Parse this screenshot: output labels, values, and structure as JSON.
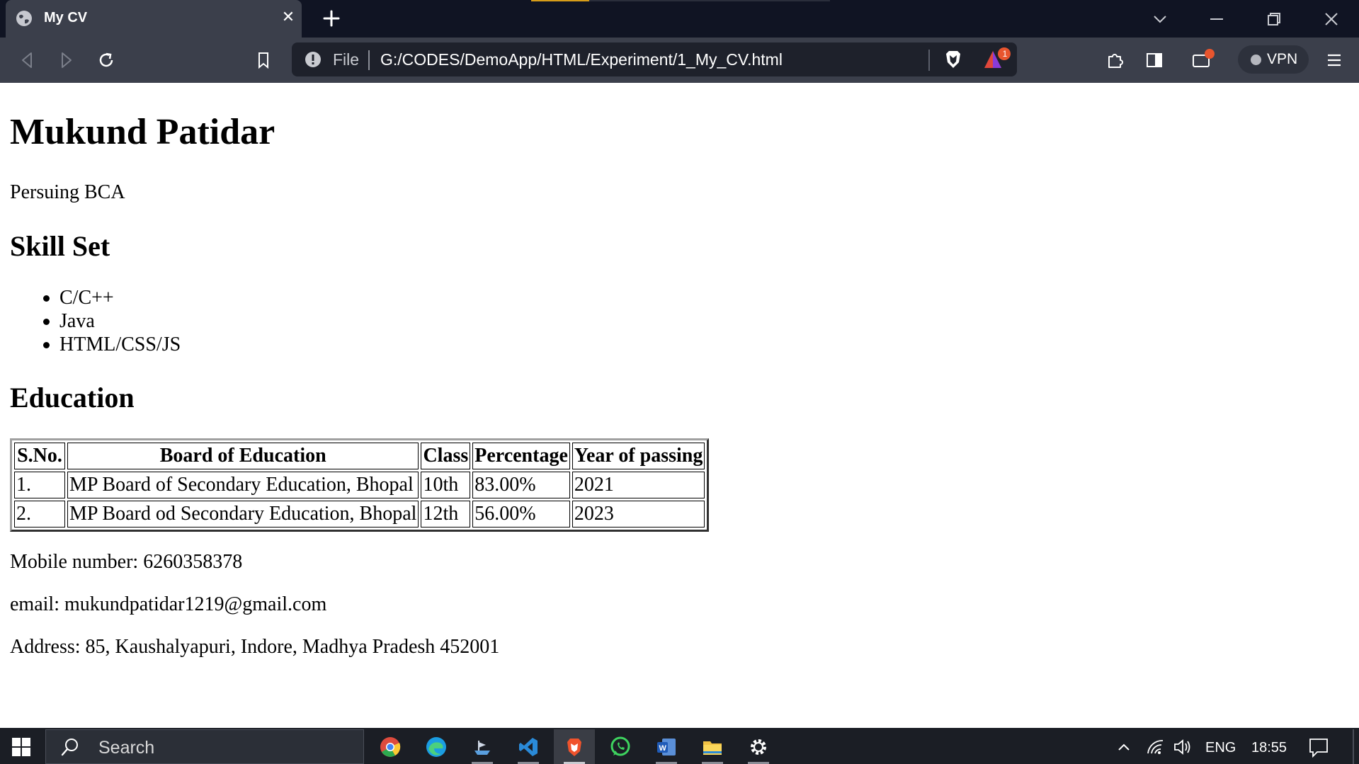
{
  "browser": {
    "tab_title": "My CV",
    "address": {
      "scheme_label": "File",
      "url": "G:/CODES/DemoApp/HTML/Experiment/1_My_CV.html"
    },
    "notification_count": "1",
    "vpn_label": "VPN",
    "accent_color": "#d79d19"
  },
  "page": {
    "name": "Mukund Patidar",
    "status": "Persuing BCA",
    "skills_heading": "Skill Set",
    "skills": [
      "C/C++",
      "Java",
      "HTML/CSS/JS"
    ],
    "education_heading": "Education",
    "education_table": {
      "headers": [
        "S.No.",
        "Board of Education",
        "Class",
        "Percentage",
        "Year of passing"
      ],
      "rows": [
        [
          "1.",
          "MP Board of Secondary Education, Bhopal",
          "10th",
          "83.00%",
          "2021"
        ],
        [
          "2.",
          "MP Board od Secondary Education, Bhopal",
          "12th",
          "56.00%",
          "2023"
        ]
      ]
    },
    "mobile": "Mobile number: 6260358378",
    "email": "email: mukundpatidar1219@gmail.com",
    "address": "Address: 85, Kaushalyapuri, Indore, Madhya Pradesh 452001"
  },
  "taskbar": {
    "search_placeholder": "Search",
    "apps": [
      "chrome-icon",
      "edge-icon",
      "ship-icon",
      "vscode-icon",
      "brave-icon",
      "whatsapp-icon",
      "word-icon",
      "file-explorer-icon",
      "settings-icon"
    ],
    "language": "ENG",
    "time": "18:55"
  }
}
